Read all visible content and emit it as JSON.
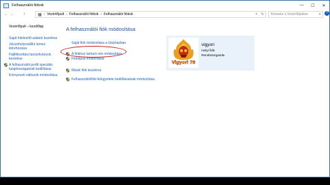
{
  "window": {
    "title": "Felhasználói fiókok"
  },
  "titlebar": {
    "minimize": "—",
    "maximize": "☐",
    "close": "✕"
  },
  "address": {
    "back": "←",
    "forward": "→",
    "up": "↑",
    "crumbs": [
      "Vezérlőpult",
      "Felhasználói fiókok",
      "Felhasználói fiókok"
    ],
    "separator": "›",
    "dropdown": "˅",
    "refresh": "↻"
  },
  "search": {
    "placeholder": "Keresés a Vezérlőpulton"
  },
  "help": "?",
  "sidebar": {
    "home": "Vezérlőpult – kezdőlap",
    "links": [
      "Saját hitelesítő adatok kezelése",
      "Jelszóhelyreállító lemez létrehozása",
      "Fájltitkosítási tanúsítványok kezelése"
    ],
    "shield_link": "A felhasználói profil speciális tulajdonságainak beállításai",
    "env_link": "Környezeti változók módosítása"
  },
  "main": {
    "heading": "A felhasználói fiók módosítása",
    "tasks": {
      "change_account": "Saját fiók módosítása a Gépházban",
      "rename": "A fiókhoz tartozó név módosítása",
      "account_type": "Fióktípus módosítása",
      "manage_other": "Másik fiók kezelése",
      "uac": "Felhasználóifiók-felügyelete beállításainak módosítása"
    }
  },
  "account": {
    "name": "vigyori",
    "type": "Helyi fiók",
    "role": "Rendszergazda",
    "avatar_text": "Vigyori 78",
    "avatar_colors": {
      "flame": "#e8a020",
      "skull": "#c03010",
      "text": "#f0c020"
    }
  },
  "colors": {
    "link": "#1e5fb4",
    "heading": "#1e4e9a",
    "annotation": "#c81e1e",
    "panel": "#e9f1fb"
  }
}
